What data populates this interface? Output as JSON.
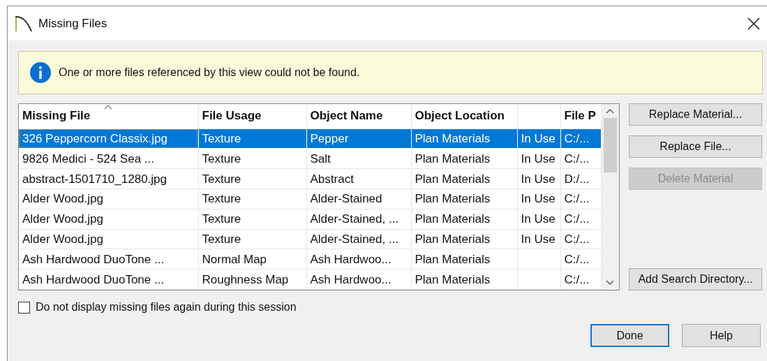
{
  "window": {
    "title": "Missing Files"
  },
  "banner": {
    "message": "One or more files referenced by this view could not be found."
  },
  "table": {
    "columns": [
      {
        "label": "Missing File",
        "sorted": true
      },
      {
        "label": "File Usage",
        "sorted": false
      },
      {
        "label": "Object Name",
        "sorted": false
      },
      {
        "label": "Object Location",
        "sorted": false
      },
      {
        "sorted": false
      },
      {
        "label": "File P",
        "sorted": false
      }
    ],
    "rows": [
      {
        "selected": true,
        "cells": [
          "326 Peppercorn Classix.jpg",
          "Texture",
          "Pepper",
          "Plan Materials",
          "In Use",
          "C:/..."
        ]
      },
      {
        "selected": false,
        "cells": [
          "9826 Medici - 524 Sea ...",
          "Texture",
          "Salt",
          "Plan Materials",
          "In Use",
          "C:/..."
        ]
      },
      {
        "selected": false,
        "cells": [
          "abstract-1501710_1280.jpg",
          "Texture",
          "Abstract",
          "Plan Materials",
          "In Use",
          "D:/..."
        ]
      },
      {
        "selected": false,
        "cells": [
          "Alder Wood.jpg",
          "Texture",
          "Alder-Stained",
          "Plan Materials",
          "In Use",
          "C:/..."
        ]
      },
      {
        "selected": false,
        "cells": [
          "Alder Wood.jpg",
          "Texture",
          "Alder-Stained, ...",
          "Plan Materials",
          "In Use",
          "C:/..."
        ]
      },
      {
        "selected": false,
        "cells": [
          "Alder Wood.jpg",
          "Texture",
          "Alder-Stained, ...",
          "Plan Materials",
          "In Use",
          "C:/..."
        ]
      },
      {
        "selected": false,
        "cells": [
          "Ash Hardwood DuoTone ...",
          "Normal Map",
          "Ash Hardwoo...",
          "Plan Materials",
          "",
          "C:/..."
        ]
      },
      {
        "selected": false,
        "cells": [
          "Ash Hardwood DuoTone ...",
          "Roughness Map",
          "Ash Hardwoo...",
          "Plan Materials",
          "",
          "C:/..."
        ]
      }
    ]
  },
  "side_buttons": [
    {
      "label": "Replace Material...",
      "disabled": false
    },
    {
      "label": "Replace File...",
      "disabled": false
    },
    {
      "label": "Delete Material",
      "disabled": true
    },
    {
      "label": "Add Search Directory...",
      "disabled": false
    }
  ],
  "checkbox": {
    "label": "Do not display missing files again during this session",
    "checked": false
  },
  "buttons": [
    {
      "label": "Done",
      "default": true
    },
    {
      "label": "Help",
      "default": false
    }
  ]
}
